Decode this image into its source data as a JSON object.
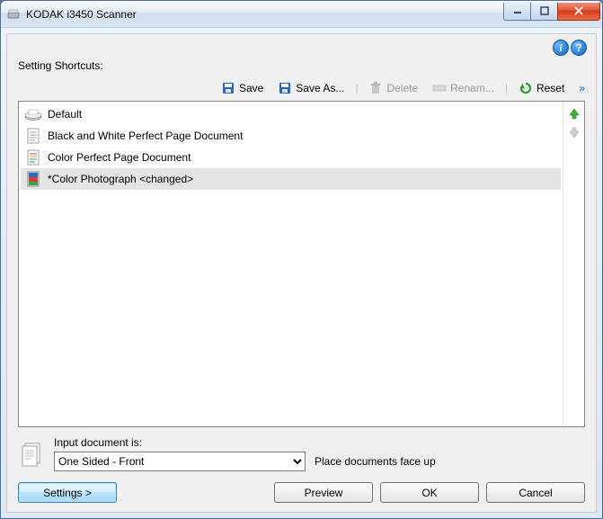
{
  "window": {
    "title": "KODAK i3450 Scanner"
  },
  "info": {
    "info_letter": "i",
    "help_letter": "?"
  },
  "shortcuts": {
    "label": "Setting Shortcuts:"
  },
  "toolbar": {
    "save": "Save",
    "save_as": "Save As...",
    "delete": "Delete",
    "rename": "Renam...",
    "reset": "Reset"
  },
  "list": {
    "items": [
      {
        "label": "Default"
      },
      {
        "label": "Black and White Perfect Page Document"
      },
      {
        "label": "Color Perfect Page Document"
      },
      {
        "label": "*Color Photograph <changed>"
      }
    ]
  },
  "input_doc": {
    "label": "Input document is:",
    "value": "One Sided - Front",
    "hint": "Place documents face up"
  },
  "buttons": {
    "settings": "Settings >",
    "preview": "Preview",
    "ok": "OK",
    "cancel": "Cancel"
  }
}
